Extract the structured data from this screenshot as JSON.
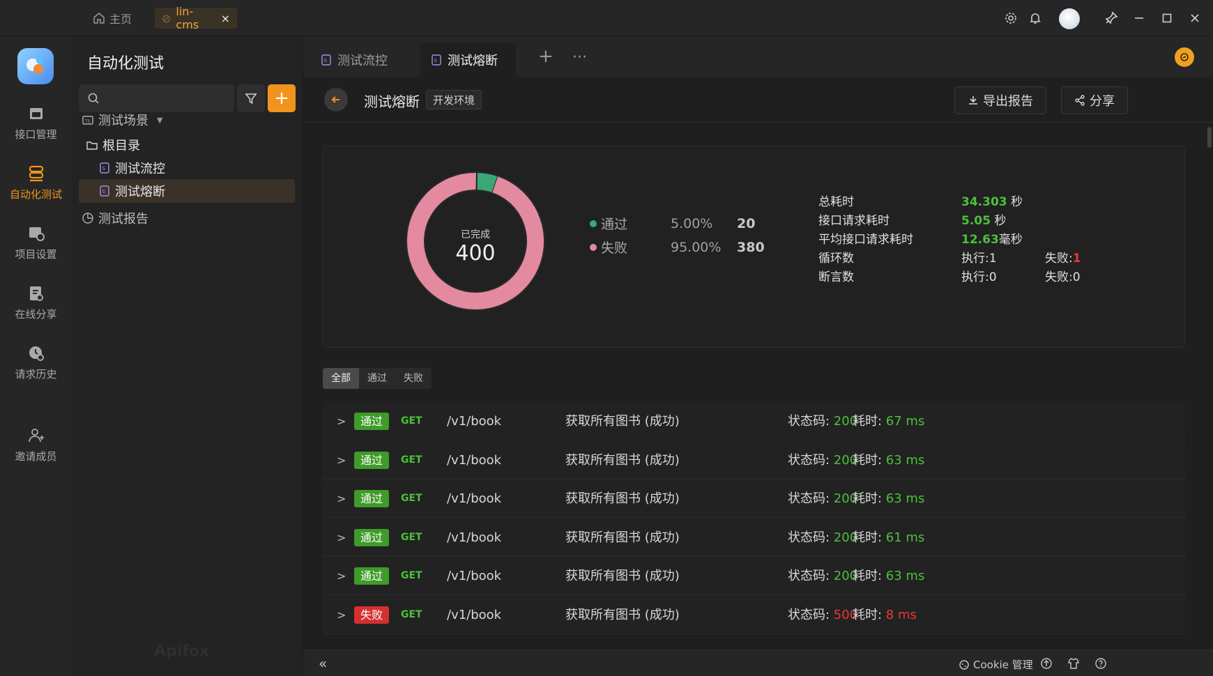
{
  "titlebar": {
    "home_label": "主页",
    "project_tab": "lin-cms",
    "close_glyph": "×"
  },
  "rail": {
    "items": [
      {
        "label": "接口管理",
        "icon": "api-icon"
      },
      {
        "label": "自动化测试",
        "icon": "automation-icon",
        "active": true
      },
      {
        "label": "项目设置",
        "icon": "project-settings-icon"
      },
      {
        "label": "在线分享",
        "icon": "share-doc-icon"
      },
      {
        "label": "请求历史",
        "icon": "history-icon"
      },
      {
        "label": "邀请成员",
        "icon": "invite-member-icon"
      }
    ]
  },
  "sidebar": {
    "title": "自动化测试",
    "search_placeholder": "",
    "add_glyph": "+",
    "tree": {
      "scenes": "测试场景",
      "root": "根目录",
      "item1": "测试流控",
      "item2": "测试熔断",
      "reports": "测试报告"
    },
    "watermark": "Apifox"
  },
  "tabs": [
    {
      "label": "测试流控"
    },
    {
      "label": "测试熔断",
      "active": true
    }
  ],
  "header": {
    "title": "测试熔断",
    "env": "开发环境",
    "export_label": "导出报告",
    "share_label": "分享"
  },
  "summary": {
    "donut_caption": "已完成",
    "total": "400",
    "pass": {
      "label": "通过",
      "pct": "5.00%",
      "count": "20",
      "color": "#3aa876"
    },
    "fail": {
      "label": "失败",
      "pct": "95.00%",
      "count": "380",
      "color": "#e38aa0"
    },
    "stats": {
      "total_time_label": "总耗时",
      "total_time": "34.303",
      "total_time_unit": " 秒",
      "api_time_label": "接口请求耗时",
      "api_time": "5.05",
      "api_time_unit": " 秒",
      "avg_time_label": "平均接口请求耗时",
      "avg_time": "12.63",
      "avg_time_unit": "毫秒",
      "loop_label": "循环数",
      "loop_exec": "执行:1",
      "loop_fail_label": "失败:",
      "loop_fail": "1",
      "assert_label": "断言数",
      "assert_exec": "执行:0",
      "assert_fail": "失败:0"
    }
  },
  "filter": {
    "all": "全部",
    "pass": "通过",
    "fail": "失败"
  },
  "results": [
    {
      "result": "通过",
      "method": "GET",
      "path": "/v1/book",
      "desc": "获取所有图书 (成功)",
      "status_label": "状态码: ",
      "status": "200",
      "time_label": "耗时: ",
      "time": "67 ms"
    },
    {
      "result": "通过",
      "method": "GET",
      "path": "/v1/book",
      "desc": "获取所有图书 (成功)",
      "status_label": "状态码: ",
      "status": "200",
      "time_label": "耗时: ",
      "time": "63 ms"
    },
    {
      "result": "通过",
      "method": "GET",
      "path": "/v1/book",
      "desc": "获取所有图书 (成功)",
      "status_label": "状态码: ",
      "status": "200",
      "time_label": "耗时: ",
      "time": "63 ms"
    },
    {
      "result": "通过",
      "method": "GET",
      "path": "/v1/book",
      "desc": "获取所有图书 (成功)",
      "status_label": "状态码: ",
      "status": "200",
      "time_label": "耗时: ",
      "time": "61 ms"
    },
    {
      "result": "通过",
      "method": "GET",
      "path": "/v1/book",
      "desc": "获取所有图书 (成功)",
      "status_label": "状态码: ",
      "status": "200",
      "time_label": "耗时: ",
      "time": "63 ms"
    },
    {
      "result": "失败",
      "method": "GET",
      "path": "/v1/book",
      "desc": "获取所有图书 (成功)",
      "status_label": "状态码: ",
      "status": "500",
      "time_label": "耗时: ",
      "time": "8 ms"
    }
  ],
  "footer": {
    "collapse_glyph": "«",
    "cookie": "Cookie 管理"
  },
  "colors": {
    "accent": "#f0941d",
    "pass": "#4cc13c",
    "fail": "#ee3535"
  }
}
